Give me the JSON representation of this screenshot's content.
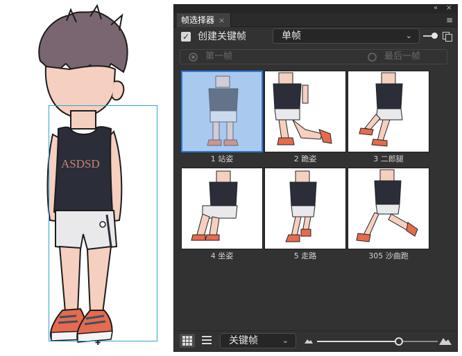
{
  "panel": {
    "title": "帧选择器",
    "tab_close": "×",
    "collapse_glyph": "«",
    "close_glyph": "×",
    "menu_glyph": "≡"
  },
  "create": {
    "checked": true,
    "check_glyph": "✓",
    "label": "创建关键帧",
    "mode_value": "单帧",
    "chevron": "⌄"
  },
  "frame_range": {
    "first_label": "第一帧",
    "last_label": "最后一帧",
    "selected": "first"
  },
  "thumbnails": [
    {
      "caption": "1 站姿",
      "pose": "stand",
      "selected": true
    },
    {
      "caption": "2 跪姿",
      "pose": "kneel",
      "selected": false
    },
    {
      "caption": "3 二郎腿",
      "pose": "crossleg",
      "selected": false
    },
    {
      "caption": "4 坐姿",
      "pose": "sit",
      "selected": false
    },
    {
      "caption": "5 走路",
      "pose": "walk",
      "selected": false
    },
    {
      "caption": "305 沙曲跑",
      "pose": "run",
      "selected": false
    }
  ],
  "bottom": {
    "view_value": "关键帧",
    "chevron": "⌄",
    "thumb_size": 0.68
  },
  "character": {
    "shirt_text": "ASDSD",
    "move_cursor": "✚"
  },
  "colors": {
    "panel_bg": "#323232",
    "selection_bg": "#a9c9ef",
    "selection_border": "#2d7ad6",
    "bbox": "#2aa3d6",
    "hair": "#7a6670",
    "skin": "#f5cfbf",
    "tank": "#2b2e38",
    "shorts": "#e9e9ec",
    "shoe": "#e66a4e"
  }
}
